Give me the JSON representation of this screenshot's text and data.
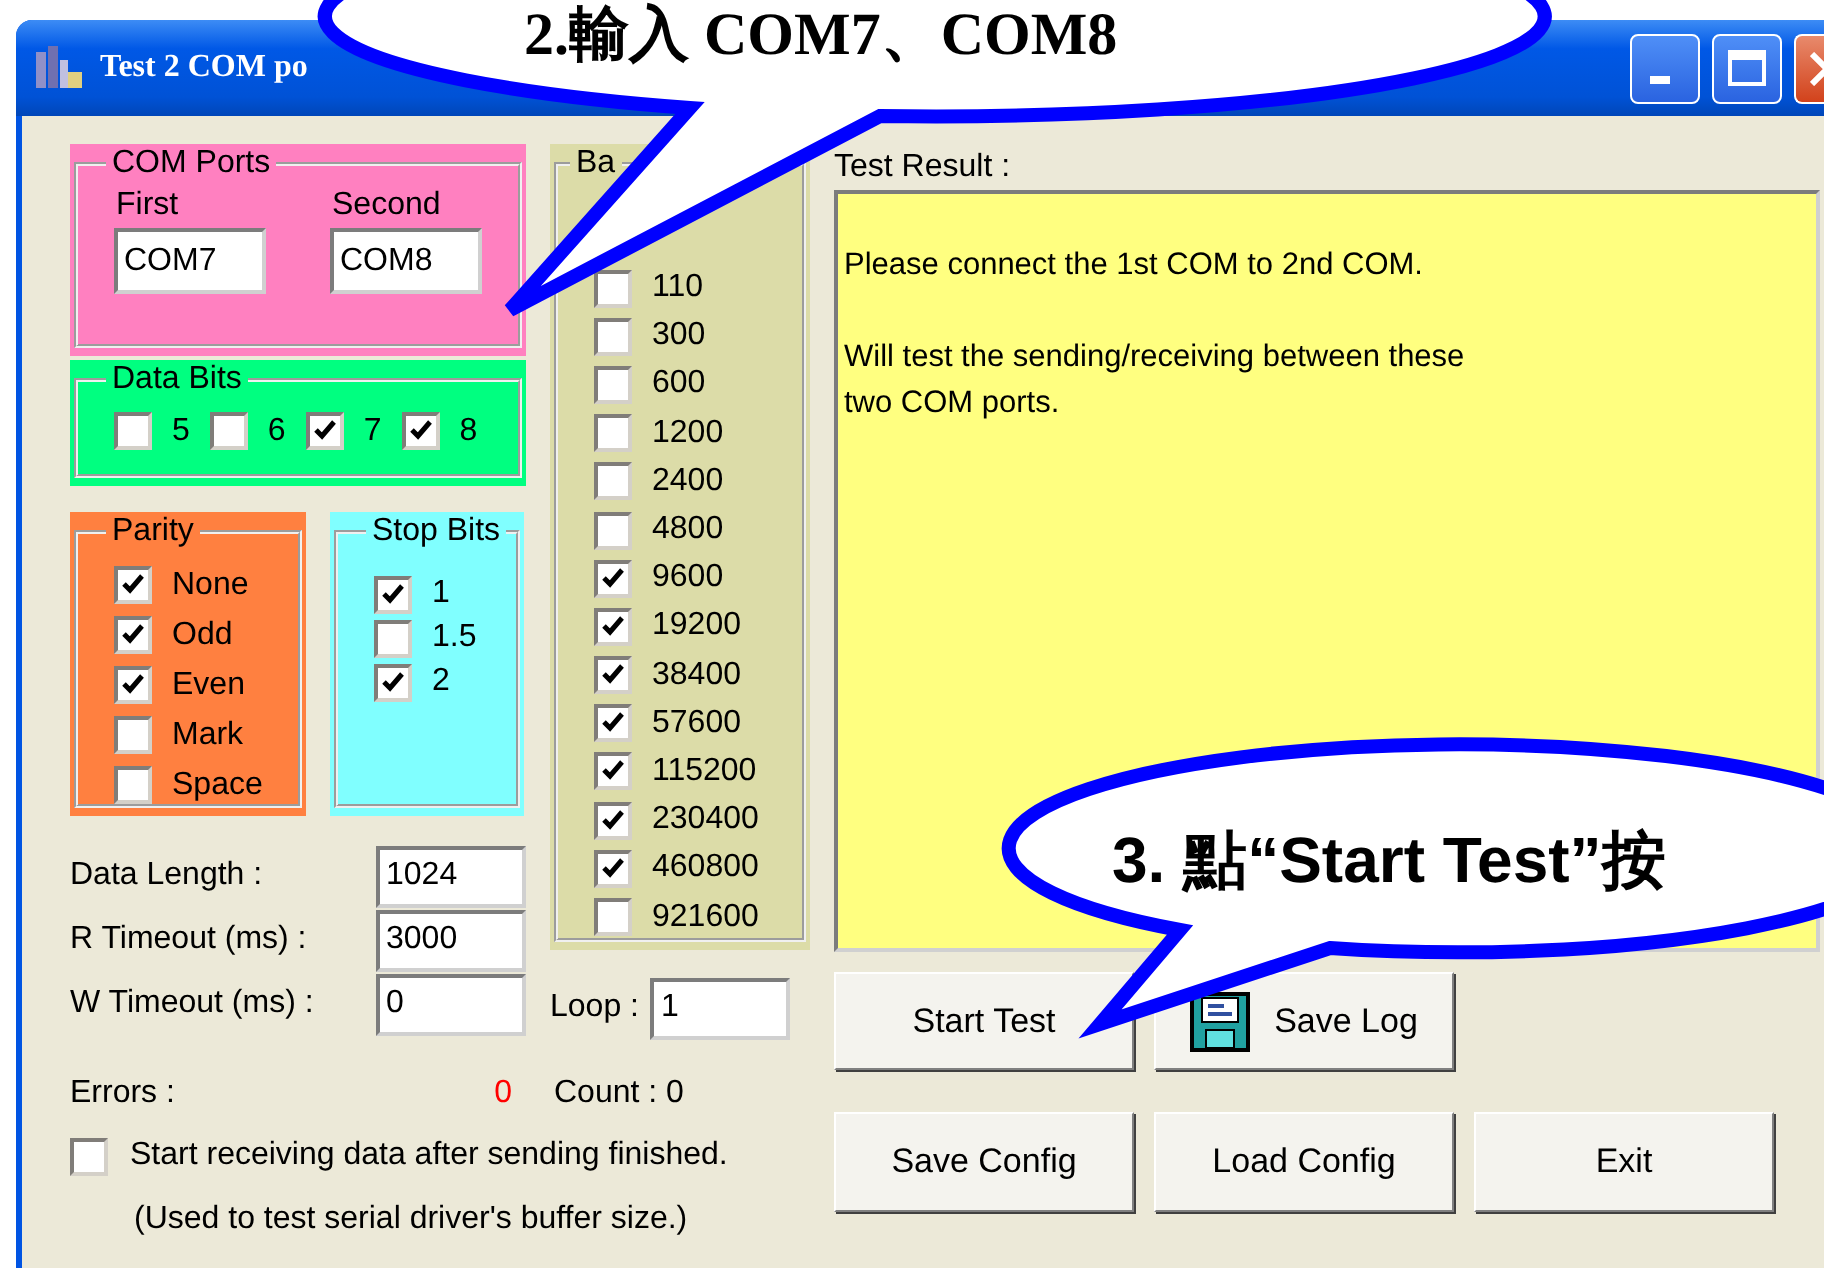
{
  "callouts": [
    {
      "text": "2.輸入 COM7、COM8"
    },
    {
      "text": "3. 點“Start Test”按"
    }
  ],
  "window": {
    "title": "Test 2 COM po"
  },
  "com_ports": {
    "label": "COM Ports",
    "fields": [
      {
        "label": "First",
        "value": "COM7"
      },
      {
        "label": "Second",
        "value": "COM8"
      }
    ]
  },
  "data_bits": {
    "label": "Data Bits",
    "options": [
      {
        "label": "5",
        "checked": false
      },
      {
        "label": "6",
        "checked": false
      },
      {
        "label": "7",
        "checked": true
      },
      {
        "label": "8",
        "checked": true
      }
    ]
  },
  "parity": {
    "label": "Parity",
    "options": [
      {
        "label": "None",
        "checked": true
      },
      {
        "label": "Odd",
        "checked": true
      },
      {
        "label": "Even",
        "checked": true
      },
      {
        "label": "Mark",
        "checked": false
      },
      {
        "label": "Space",
        "checked": false
      }
    ]
  },
  "stop_bits": {
    "label": "Stop Bits",
    "options": [
      {
        "label": "1",
        "checked": true
      },
      {
        "label": "1.5",
        "checked": false
      },
      {
        "label": "2",
        "checked": true
      }
    ]
  },
  "baud": {
    "label": "Ba",
    "options": [
      {
        "label": "110",
        "checked": false
      },
      {
        "label": "300",
        "checked": false
      },
      {
        "label": "600",
        "checked": false
      },
      {
        "label": "1200",
        "checked": false
      },
      {
        "label": "2400",
        "checked": false
      },
      {
        "label": "4800",
        "checked": false
      },
      {
        "label": "9600",
        "checked": true
      },
      {
        "label": "19200",
        "checked": true
      },
      {
        "label": "38400",
        "checked": true
      },
      {
        "label": "57600",
        "checked": true
      },
      {
        "label": "115200",
        "checked": true
      },
      {
        "label": "230400",
        "checked": true
      },
      {
        "label": "460800",
        "checked": true
      },
      {
        "label": "921600",
        "checked": false
      }
    ]
  },
  "settings": [
    {
      "label": "Data Length :",
      "value": "1024"
    },
    {
      "label": "R Timeout (ms) :",
      "value": "3000"
    },
    {
      "label": "W Timeout (ms) :",
      "value": "0"
    }
  ],
  "loop": {
    "label": "Loop :",
    "value": "1"
  },
  "test_result": {
    "label": "Test Result :",
    "paragraphs": [
      [
        "Please connect the 1st COM to 2nd COM."
      ],
      [
        "Will test the sending/receiving between these",
        "two COM ports."
      ]
    ]
  },
  "action_buttons": [
    {
      "label": "Start Test",
      "kind": "text"
    },
    {
      "label": "Save Log",
      "kind": "icon-text"
    }
  ],
  "errors": {
    "label": "Errors :",
    "value": "0"
  },
  "count": "Count : 0",
  "receive_option": {
    "label": "Start receiving data after sending finished.",
    "checked": false
  },
  "note": "(Used to test serial driver's buffer size.)",
  "config_buttons": [
    {
      "label": "Save Config"
    },
    {
      "label": "Load Config"
    },
    {
      "label": "Exit"
    }
  ]
}
